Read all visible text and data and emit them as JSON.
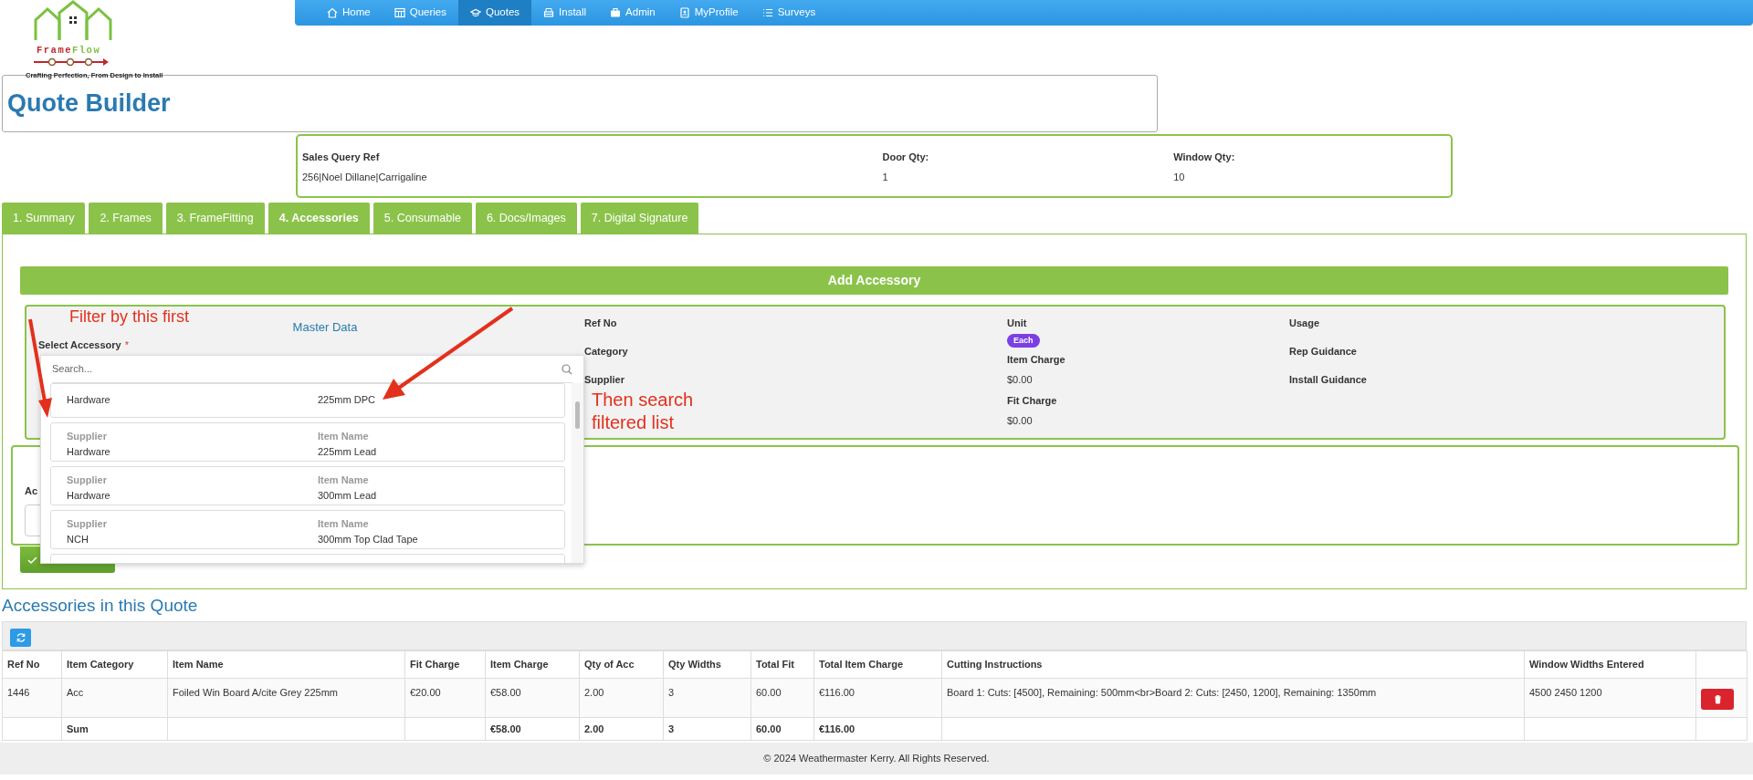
{
  "logo": {
    "name_first": "Frame",
    "name_second": "Flow",
    "tagline": "Crafting Perfection, From Design to Install"
  },
  "nav": [
    {
      "label": "Home",
      "selected": false
    },
    {
      "label": "Queries",
      "selected": false
    },
    {
      "label": "Quotes",
      "selected": true
    },
    {
      "label": "Install",
      "selected": false
    },
    {
      "label": "Admin",
      "selected": false
    },
    {
      "label": "MyProfile",
      "selected": false
    },
    {
      "label": "Surveys",
      "selected": false
    }
  ],
  "page_title": "Quote Builder",
  "sales_query": [
    {
      "label": "Sales Query Ref",
      "value": "256|Noel Dillane|Carrigaline"
    },
    {
      "label": "Door Qty:",
      "value": "1"
    },
    {
      "label": "Window Qty:",
      "value": "10"
    }
  ],
  "tabs": [
    {
      "label": "1. Summary",
      "selected": false
    },
    {
      "label": "2. Frames",
      "selected": false
    },
    {
      "label": "3. FrameFitting",
      "selected": false
    },
    {
      "label": "4. Accessories",
      "selected": true
    },
    {
      "label": "5. Consumable",
      "selected": false
    },
    {
      "label": "6. Docs/Images",
      "selected": false
    },
    {
      "label": "7. Digital Signature",
      "selected": false
    }
  ],
  "add_accessory": "Add Accessory",
  "master_data": {
    "title": "Master Data",
    "select_label": "Select Accessory",
    "required_mark": "*",
    "columns": [
      [
        {
          "label": "Ref No"
        },
        {
          "label": "Category"
        },
        {
          "label": "Supplier"
        }
      ],
      [
        {
          "label": "Unit",
          "badge": "Each"
        },
        {
          "label": "Item Charge",
          "value": "$0.00"
        },
        {
          "label": "Fit Charge",
          "value": "$0.00"
        }
      ],
      [
        {
          "label": "Usage"
        },
        {
          "label": "Rep Guidance"
        },
        {
          "label": "Install Guidance"
        }
      ]
    ]
  },
  "dropdown": {
    "placeholder": "Search...",
    "options": [
      {
        "supplier": "Hardware",
        "item_name": "225mm DPC"
      },
      {
        "supplier_label": "Supplier",
        "supplier": "Hardware",
        "item_label": "Item Name",
        "item_name": "225mm Lead"
      },
      {
        "supplier_label": "Supplier",
        "supplier": "Hardware",
        "item_label": "Item Name",
        "item_name": "300mm Lead"
      },
      {
        "supplier_label": "Supplier",
        "supplier": "NCH",
        "item_label": "Item Name",
        "item_name": "300mm Top Clad Tape"
      }
    ]
  },
  "accessory_field": {
    "label": "Ac"
  },
  "annotations": [
    {
      "text": "Filter by this first"
    },
    {
      "text": "Then search filtered list"
    }
  ],
  "section_title": "Accessories in this Quote",
  "table": {
    "columns": [
      "Ref No",
      "Item Category",
      "Item Name",
      "Fit Charge",
      "Item Charge",
      "Qty of Acc",
      "Qty Widths",
      "Total Fit",
      "Total Item Charge",
      "Cutting Instructions",
      "Window Widths Entered"
    ],
    "rows": [
      {
        "kind": "item",
        "cells": [
          "1446",
          "Acc",
          "Foiled Win Board A/cite Grey 225mm",
          "€20.00",
          "€58.00",
          "2.00",
          "3",
          "60.00",
          "€116.00",
          "Board 1: Cuts: [4500], Remaining: 500mm<br>Board 2: Cuts: [2450, 1200], Remaining: 1350mm",
          "4500 2450 1200"
        ]
      },
      {
        "kind": "total",
        "cells": [
          null,
          "Sum",
          null,
          null,
          "€58.00",
          "2.00",
          "3",
          "60.00",
          "€116.00",
          null,
          null
        ]
      }
    ]
  },
  "footer": "© 2024 Weathermaster Kerry. All Rights Reserved."
}
